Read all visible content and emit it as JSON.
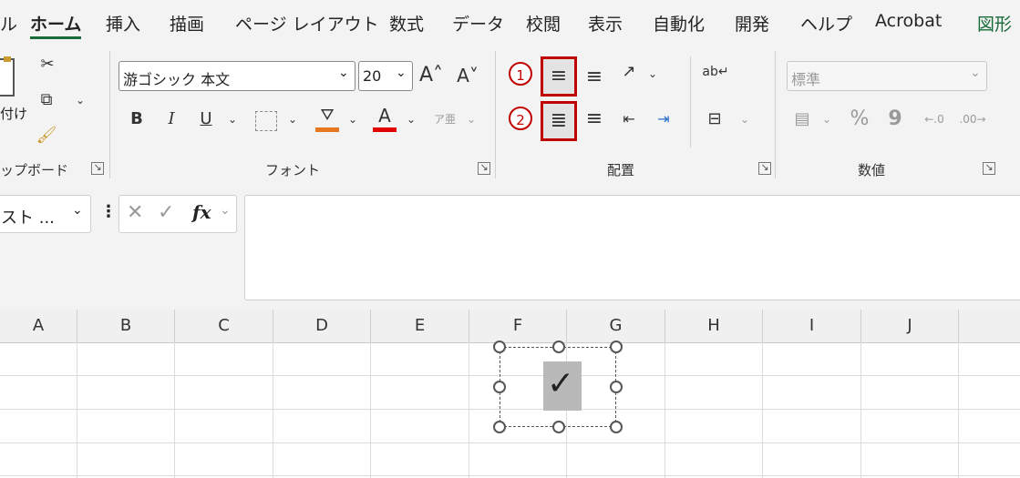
{
  "tabs": [
    "ホーム",
    "挿入",
    "描画",
    "ページ レイアウト",
    "数式",
    "データ",
    "校閲",
    "表示",
    "自動化",
    "開発",
    "ヘルプ",
    "Acrobat",
    "図形"
  ],
  "tab_prefix": "ル",
  "clipboard": {
    "paste_partial": "付け",
    "label": "ップボード"
  },
  "font": {
    "name": "游ゴシック 本文",
    "size": "20",
    "label": "フォント"
  },
  "alignment": {
    "label": "配置",
    "marker1": "1",
    "marker2": "2"
  },
  "number": {
    "format": "標準",
    "percent": "%",
    "comma": "9",
    "label": "数値"
  },
  "formula_bar": {
    "name_box": "スト ...",
    "fx": "fx"
  },
  "columns": [
    "A",
    "B",
    "C",
    "D",
    "E",
    "F",
    "G",
    "H",
    "I",
    "J"
  ],
  "checkbox": {
    "symbol": "✓"
  },
  "colors": {
    "accent": "#1b6b3a",
    "highlight": "#c00000",
    "fill": "#e87722",
    "font_color": "#e00000"
  }
}
